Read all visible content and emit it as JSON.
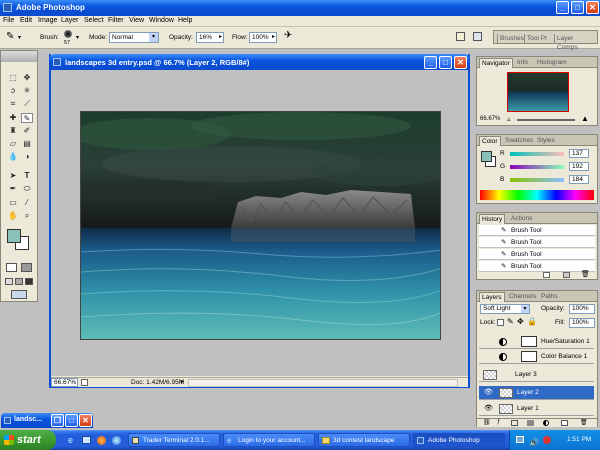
{
  "app": {
    "title": "Adobe Photoshop"
  },
  "menu": [
    "File",
    "Edit",
    "Image",
    "Layer",
    "Select",
    "Filter",
    "View",
    "Window",
    "Help"
  ],
  "options": {
    "brush_label": "Brush:",
    "brush_size": "57",
    "mode_label": "Mode:",
    "mode_value": "Normal",
    "opacity_label": "Opacity:",
    "opacity_value": "16%",
    "flow_label": "Flow:",
    "flow_value": "100%",
    "well_tabs": [
      "Brushes",
      "Tool Pr",
      "Layer Comps"
    ]
  },
  "document": {
    "title": "landscapes 3d entry.psd @ 66.7% (Layer 2, RGB/8#)",
    "zoom": "66.67%",
    "doc_size": "Doc: 1.42M/6.95M"
  },
  "navigator": {
    "tabs": [
      "Navigator",
      "Info",
      "Histogram"
    ],
    "zoom": "66.67%"
  },
  "color": {
    "tabs": [
      "Color",
      "Swatches",
      "Styles"
    ],
    "r_label": "R",
    "r_value": "137",
    "g_label": "G",
    "g_value": "192",
    "b_label": "B",
    "b_value": "184",
    "foreground_hex": "#89c0b8"
  },
  "history": {
    "tabs": [
      "History",
      "Actions"
    ],
    "items": [
      "Brush Tool",
      "Brush Tool",
      "Brush Tool",
      "Brush Tool"
    ]
  },
  "layers": {
    "tabs": [
      "Layers",
      "Channels",
      "Paths"
    ],
    "blend_mode": "Soft Light",
    "opacity_label": "Opacity:",
    "opacity_value": "100%",
    "lock_label": "Lock:",
    "fill_label": "Fill:",
    "fill_value": "100%",
    "items": [
      "Hue/Saturation 1",
      "Color Balance 1",
      "Layer 3",
      "Layer 2",
      "Layer 1"
    ]
  },
  "minimized": {
    "label": "landsc..."
  },
  "taskbar": {
    "start": "start",
    "tasks": [
      "Trader Terminal 2.0.1...",
      "Login to your account...",
      "3d contest landscape",
      "Adobe Photoshop"
    ],
    "clock": "1:51 PM"
  }
}
